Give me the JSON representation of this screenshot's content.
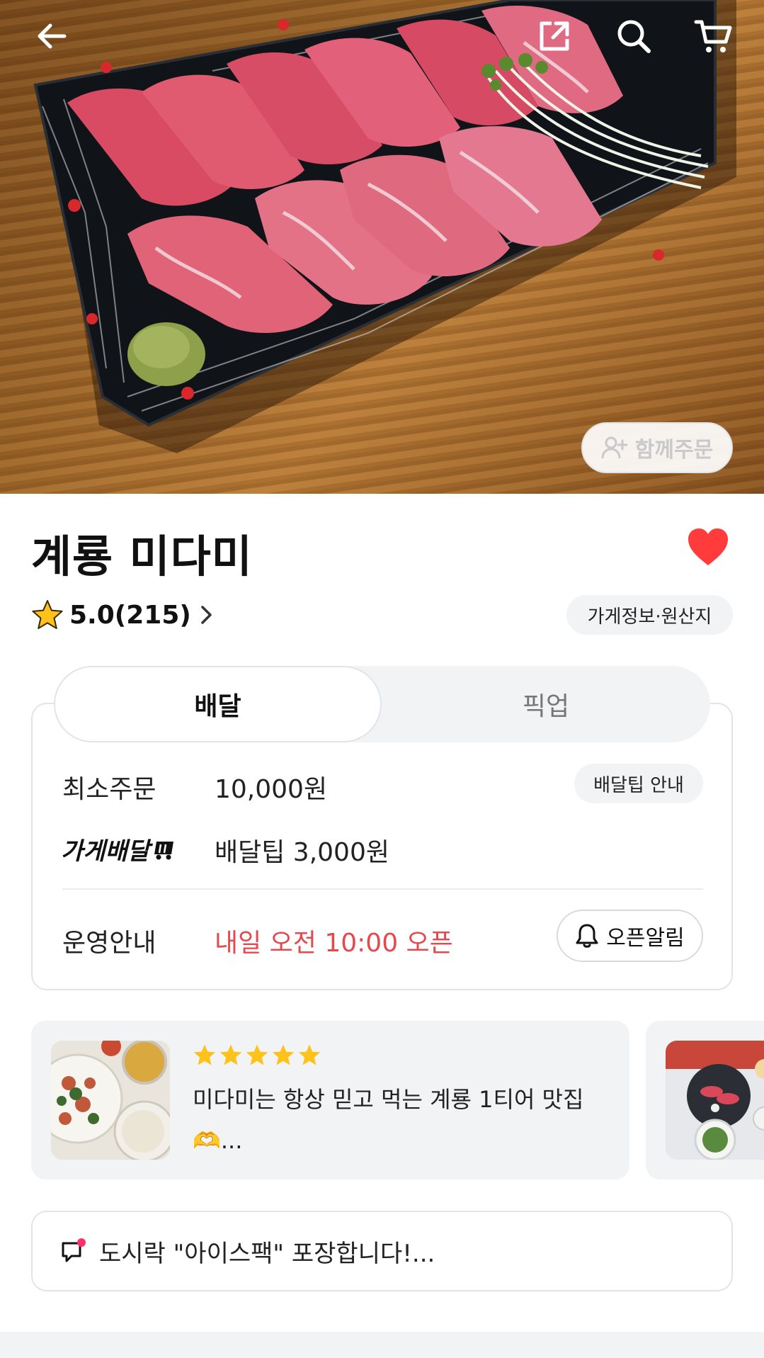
{
  "header": {
    "back_icon": "arrow-left-icon",
    "share_icon": "share-icon",
    "search_icon": "search-icon",
    "cart_icon": "cart-icon",
    "together_order_label": "함께주문"
  },
  "store": {
    "name": "계룡 미다미",
    "favorited": true,
    "rating": "5.0(215)",
    "info_chip": "가게정보·원산지"
  },
  "order_tabs": {
    "tabs": [
      {
        "label": "배달",
        "active": true
      },
      {
        "label": "픽업",
        "active": false
      }
    ]
  },
  "delivery": {
    "min_order_label": "최소주문",
    "min_order_value": "10,000원",
    "tip_info_chip": "배달팁 안내",
    "store_delivery_label": "가게배달",
    "delivery_tip_value": "배달팁 3,000원",
    "hours_label": "운영안내",
    "hours_value": "내일 오전 10:00 오픈",
    "hours_color": "#e5484d",
    "open_alarm_label": "오픈알림"
  },
  "reviews": [
    {
      "rating": 5,
      "text": "미다미는 항상 믿고 먹는 계룡 1티어 맛집 🫶..."
    }
  ],
  "notice": {
    "text": "도시락 \"아이스팩\" 포장합니다!..."
  },
  "colors": {
    "heart": "#ff3b3b",
    "star": "#ffc21a",
    "chip_bg": "#f2f3f5"
  }
}
